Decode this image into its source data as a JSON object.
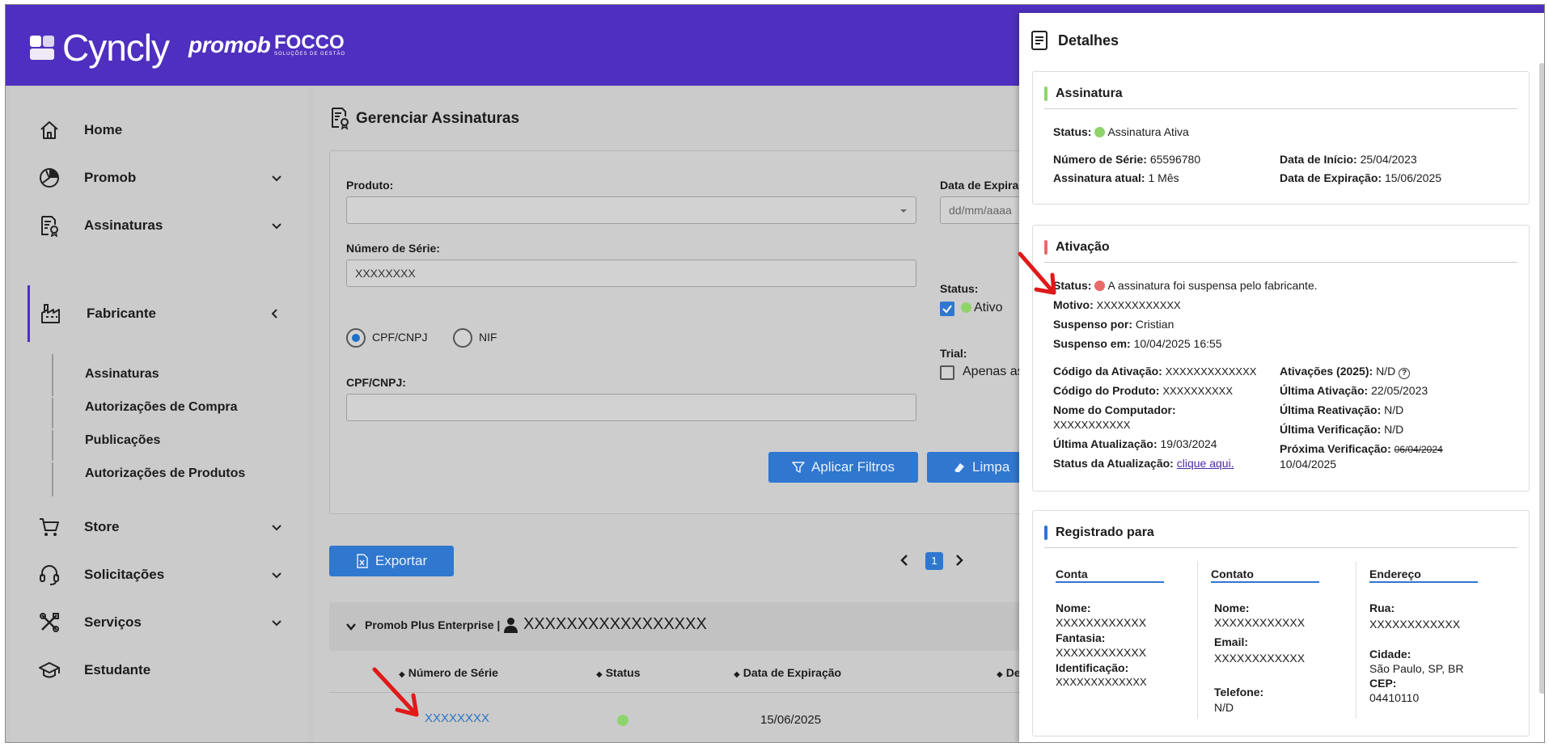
{
  "header": {
    "brand_cyncly": "Cyncly",
    "brand_promob": "promob",
    "brand_focco": "FOCCO",
    "brand_focco_tag": "SOLUÇÕES DE GESTÃO"
  },
  "sidebar": {
    "items": [
      {
        "label": "Home",
        "icon": "house-icon"
      },
      {
        "label": "Promob",
        "icon": "promob-logo-icon"
      },
      {
        "label": "Assinaturas",
        "icon": "document-badge-icon"
      },
      {
        "label": "Fabricante",
        "icon": "factory-icon"
      },
      {
        "label": "Store",
        "icon": "cart-icon"
      },
      {
        "label": "Solicitações",
        "icon": "headset-icon"
      },
      {
        "label": "Serviços",
        "icon": "tools-icon"
      },
      {
        "label": "Estudante",
        "icon": "graduation-cap-icon"
      }
    ],
    "fabricante_sub": [
      "Assinaturas",
      "Autorizações de Compra",
      "Publicações",
      "Autorizações de Produtos"
    ]
  },
  "main": {
    "title": "Gerenciar Assinaturas",
    "filters": {
      "produto_label": "Produto:",
      "produto_value": "",
      "data_expiracao_label": "Data de Expira",
      "data_expiracao_placeholder": "dd/mm/aaaa",
      "numero_serie_label": "Número de Série:",
      "numero_serie_value": "XXXXXXXX",
      "status_label": "Status:",
      "status_option": "Ativo",
      "radio_cpf": "CPF/CNPJ",
      "radio_nif": "NIF",
      "trial_label": "Trial:",
      "trial_option": "Apenas as",
      "cpf_label": "CPF/CNPJ:",
      "cpf_value": "",
      "apply_button": "Aplicar Filtros",
      "clear_button": "Limpa"
    },
    "export_button": "Exportar",
    "pagination": {
      "current": "1"
    },
    "group": {
      "product": "Promob Plus Enterprise |",
      "owner": "XXXXXXXXXXXXXXXXX"
    },
    "table": {
      "headers": [
        "Número de Série",
        "Status",
        "Data de Expiração",
        "De"
      ],
      "rows": [
        {
          "serial": "XXXXXXXX",
          "expiration": "15/06/2025"
        }
      ]
    }
  },
  "panel": {
    "title": "Detalhes",
    "assinatura": {
      "title": "Assinatura",
      "status_label": "Status:",
      "status_value": "Assinatura Ativa",
      "serie_label": "Número de Série:",
      "serie_value": "65596780",
      "atual_label": "Assinatura atual:",
      "atual_value": "1 Mês",
      "inicio_label": "Data de Início:",
      "inicio_value": "25/04/2023",
      "expiracao_label": "Data de Expiração:",
      "expiracao_value": "15/06/2025"
    },
    "ativacao": {
      "title": "Ativação",
      "status_label": "Status:",
      "status_value": "A assinatura foi suspensa pelo fabricante.",
      "motivo_label": "Motivo:",
      "motivo_value": "XXXXXXXXXXXX",
      "suspenso_por_label": "Suspenso por:",
      "suspenso_por_value": "Cristian",
      "suspenso_em_label": "Suspenso em:",
      "suspenso_em_value": "10/04/2025 16:55",
      "codigo_ativacao_label": "Código da Ativação:",
      "codigo_ativacao_value": "XXXXXXXXXXXXX",
      "codigo_produto_label": "Código do Produto:",
      "codigo_produto_value": "XXXXXXXXXX",
      "nome_computador_label": "Nome do Computador:",
      "nome_computador_value": "XXXXXXXXXXX",
      "ultima_atualizacao_label": "Última Atualização:",
      "ultima_atualizacao_value": "19/03/2024",
      "status_atualizacao_label": "Status da Atualização:",
      "status_atualizacao_link": "clique aqui.",
      "ativacoes_label": "Ativações (2025):",
      "ativacoes_value": "N/D",
      "ultima_ativacao_label": "Última Ativação:",
      "ultima_ativacao_value": "22/05/2023",
      "ultima_reativacao_label": "Última Reativação:",
      "ultima_reativacao_value": "N/D",
      "ultima_verificacao_label": "Última Verificação:",
      "ultima_verificacao_value": "N/D",
      "proxima_verificacao_label": "Próxima Verificação:",
      "proxima_verificacao_old": "06/04/2024",
      "proxima_verificacao_value": "10/04/2025"
    },
    "registrado": {
      "title": "Registrado para",
      "conta": {
        "heading": "Conta",
        "nome_label": "Nome:",
        "nome_value": "XXXXXXXXXXXX",
        "fantasia_label": "Fantasia:",
        "fantasia_value": "XXXXXXXXXXXX",
        "identificacao_label": "Identificação:",
        "identificacao_value": "XXXXXXXXXXXXX"
      },
      "contato": {
        "heading": "Contato",
        "nome_label": "Nome:",
        "nome_value": "XXXXXXXXXXXX",
        "email_label": "Email:",
        "email_value": "XXXXXXXXXXXX",
        "telefone_label": "Telefone:",
        "telefone_value": "N/D"
      },
      "endereco": {
        "heading": "Endereço",
        "rua_label": "Rua:",
        "rua_value": "XXXXXXXXXXXX",
        "cidade_label": "Cidade:",
        "cidade_value": "São Paulo, SP, BR",
        "cep_label": "CEP:",
        "cep_value": "04410110"
      }
    }
  },
  "colors": {
    "header": "#4f2fbf",
    "accent_blue": "#2f77cf",
    "status_active": "#8fd46b",
    "status_suspended": "#e86a6a",
    "annotation_arrow": "#e01919"
  }
}
